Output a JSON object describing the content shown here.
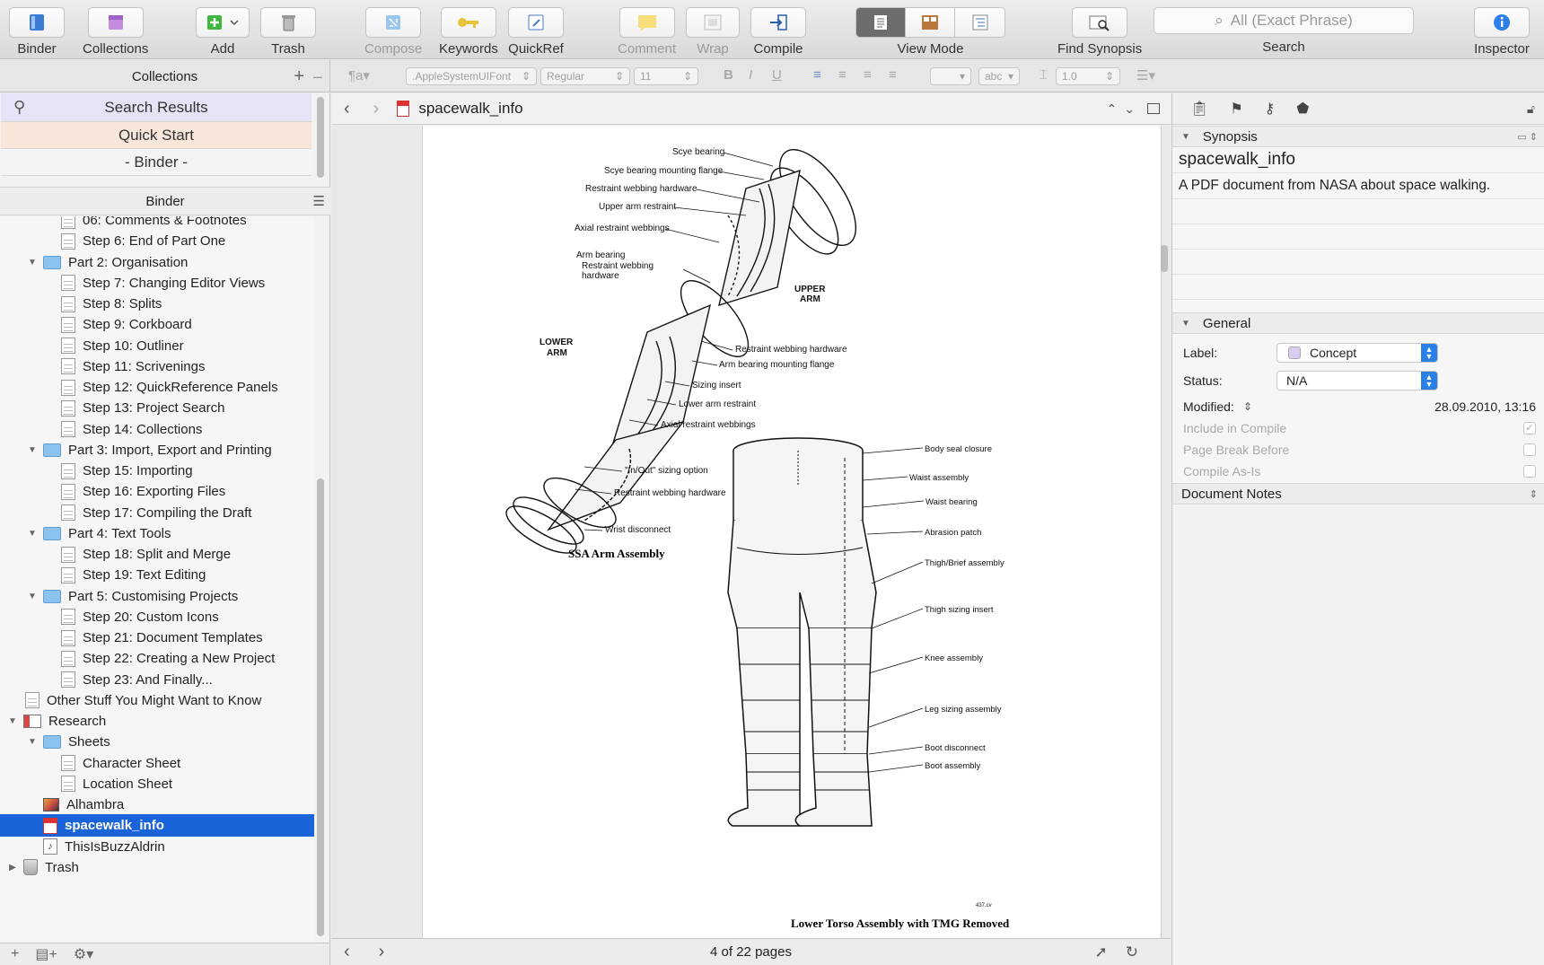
{
  "toolbar": {
    "binder": "Binder",
    "collections": "Collections",
    "add": "Add",
    "trash": "Trash",
    "compose": "Compose",
    "keywords": "Keywords",
    "quickref": "QuickRef",
    "comment": "Comment",
    "wrap": "Wrap",
    "compile": "Compile",
    "view_mode": "View Mode",
    "find_synopsis": "Find Synopsis",
    "search_placeholder": "All (Exact Phrase)",
    "search_label": "Search",
    "inspector": "Inspector"
  },
  "formatbar": {
    "collections_title": "Collections",
    "font": ".AppleSystemUIFont",
    "style": "Regular",
    "size": "11",
    "highlight": "abc",
    "line_spacing": "1.0"
  },
  "sidebar": {
    "collection_tabs": [
      "Search Results",
      "Quick Start",
      "- Binder -"
    ],
    "binder_title": "Binder",
    "items": [
      {
        "label": "06: Comments & Footnotes",
        "indent": 3,
        "icon": "doc"
      },
      {
        "label": "Step 6: End of Part One",
        "indent": 3,
        "icon": "doc"
      },
      {
        "label": "Part 2: Organisation",
        "indent": 2,
        "icon": "folder",
        "expanded": true
      },
      {
        "label": "Step 7: Changing Editor Views",
        "indent": 3,
        "icon": "doc"
      },
      {
        "label": "Step 8: Splits",
        "indent": 3,
        "icon": "doc"
      },
      {
        "label": "Step 9: Corkboard",
        "indent": 3,
        "icon": "doc"
      },
      {
        "label": "Step 10: Outliner",
        "indent": 3,
        "icon": "doc"
      },
      {
        "label": "Step 11: Scrivenings",
        "indent": 3,
        "icon": "doc"
      },
      {
        "label": "Step 12: QuickReference Panels",
        "indent": 3,
        "icon": "doc"
      },
      {
        "label": "Step 13: Project Search",
        "indent": 3,
        "icon": "doc"
      },
      {
        "label": "Step 14: Collections",
        "indent": 3,
        "icon": "doc"
      },
      {
        "label": "Part 3: Import, Export and Printing",
        "indent": 2,
        "icon": "folder",
        "expanded": true
      },
      {
        "label": "Step 15: Importing",
        "indent": 3,
        "icon": "doc"
      },
      {
        "label": "Step 16: Exporting Files",
        "indent": 3,
        "icon": "doc"
      },
      {
        "label": "Step 17: Compiling the Draft",
        "indent": 3,
        "icon": "doc"
      },
      {
        "label": "Part 4: Text Tools",
        "indent": 2,
        "icon": "folder",
        "expanded": true
      },
      {
        "label": "Step 18: Split and Merge",
        "indent": 3,
        "icon": "doc"
      },
      {
        "label": "Step 19: Text Editing",
        "indent": 3,
        "icon": "doc"
      },
      {
        "label": "Part 5: Customising Projects",
        "indent": 2,
        "icon": "folder",
        "expanded": true
      },
      {
        "label": "Step 20: Custom Icons",
        "indent": 3,
        "icon": "doc"
      },
      {
        "label": "Step 21: Document Templates",
        "indent": 3,
        "icon": "doc"
      },
      {
        "label": "Step 22: Creating a New Project",
        "indent": 3,
        "icon": "doc"
      },
      {
        "label": "Step 23: And Finally...",
        "indent": 3,
        "icon": "doc"
      },
      {
        "label": "Other Stuff You Might Want to Know",
        "indent": 1,
        "icon": "doc"
      },
      {
        "label": "Research",
        "indent": 0,
        "icon": "research",
        "expanded": true
      },
      {
        "label": "Sheets",
        "indent": 2,
        "icon": "folder",
        "expanded": true
      },
      {
        "label": "Character Sheet",
        "indent": 3,
        "icon": "doc"
      },
      {
        "label": "Location Sheet",
        "indent": 3,
        "icon": "doc"
      },
      {
        "label": "Alhambra",
        "indent": 2,
        "icon": "img"
      },
      {
        "label": "spacewalk_info",
        "indent": 2,
        "icon": "pdf",
        "selected": true
      },
      {
        "label": "ThisIsBuzzAldrin",
        "indent": 2,
        "icon": "audio"
      },
      {
        "label": "Trash",
        "indent": 0,
        "icon": "trash",
        "collapsed": true
      }
    ]
  },
  "editor": {
    "title": "spacewalk_info",
    "page_status": "4 of 22 pages",
    "figure1_caption": "SSA Arm Assembly",
    "figure2_caption": "Lower Torso Assembly with TMG Removed",
    "arm_labels": {
      "scye_bearing": "Scye bearing",
      "scye_flange": "Scye bearing mounting flange",
      "restraint_hw1": "Restraint webbing hardware",
      "upper_arm_restraint": "Upper arm restraint",
      "axial1": "Axial restraint webbings",
      "arm_bearing": "Arm bearing",
      "restraint_webbing": "Restraint webbing",
      "hardware": "hardware",
      "upper": "UPPER",
      "arm1": "ARM",
      "lower": "LOWER",
      "arm2": "ARM",
      "restraint_hw2": "Restraint webbing hardware",
      "arm_bearing_flange": "Arm bearing mounting flange",
      "sizing_insert": "Sizing insert",
      "lower_arm_restraint": "Lower arm restraint",
      "axial2": "Axial restraint webbings",
      "in_out": "\"In/Out\" sizing option",
      "restraint_hw3": "Restraint webbing hardware",
      "wrist": "Wrist disconnect"
    },
    "torso_labels": {
      "body_seal": "Body seal closure",
      "waist_assembly": "Waist assembly",
      "waist_bearing": "Waist bearing",
      "abrasion": "Abrasion patch",
      "thigh_brief": "Thigh/Brief assembly",
      "thigh_sizing": "Thigh sizing insert",
      "knee": "Knee assembly",
      "leg_sizing": "Leg sizing assembly",
      "boot_disconnect": "Boot disconnect",
      "boot_assembly": "Boot assembly",
      "figure_id": "437.cv"
    }
  },
  "inspector": {
    "synopsis_header": "Synopsis",
    "synopsis_title": "spacewalk_info",
    "synopsis_text": "A PDF document from NASA about space walking.",
    "general_header": "General",
    "label_label": "Label:",
    "label_value": "Concept",
    "label_color": "#d9ccf0",
    "status_label": "Status:",
    "status_value": "N/A",
    "modified_label": "Modified:",
    "modified_value": "28.09.2010, 13:16",
    "include_compile": "Include in Compile",
    "page_break": "Page Break Before",
    "compile_as_is": "Compile As-Is",
    "document_notes": "Document Notes"
  },
  "colors": {
    "selection": "#1a63d8",
    "accent": "#2d7fe8",
    "search_results_tab": "#e7e2f5",
    "quick_start_tab": "#f8e6da"
  }
}
